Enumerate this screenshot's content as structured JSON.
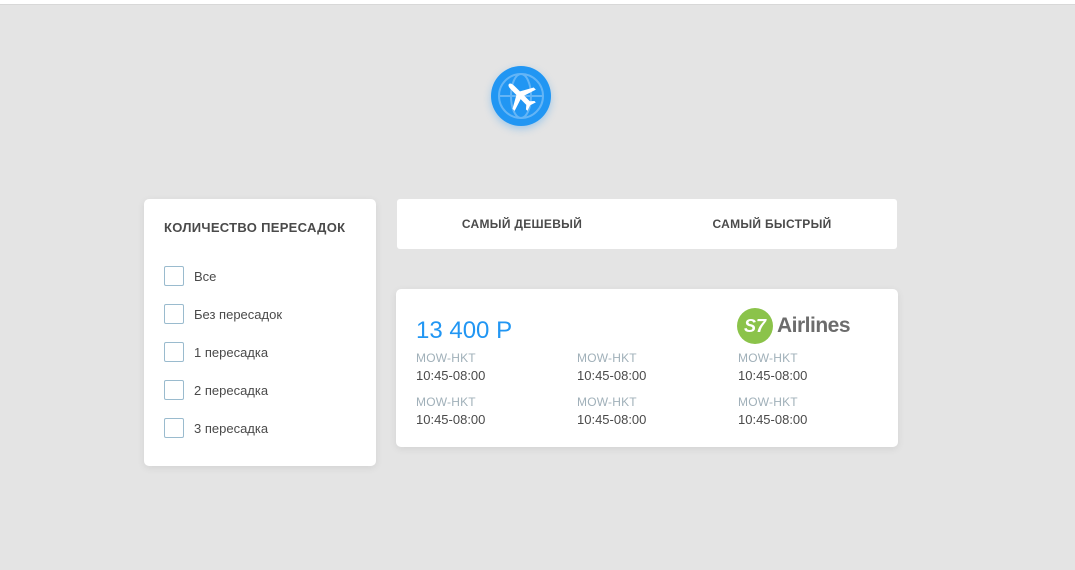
{
  "filter": {
    "title": "КОЛИЧЕСТВО ПЕРЕСАДОК",
    "options": [
      {
        "label": "Все"
      },
      {
        "label": "Без пересадок"
      },
      {
        "label": "1 пересадка"
      },
      {
        "label": "2 пересадка"
      },
      {
        "label": "3 пересадка"
      }
    ]
  },
  "tabs": [
    {
      "label": "САМЫЙ ДЕШЕВЫЙ"
    },
    {
      "label": "САМЫЙ БЫСТРЫЙ"
    }
  ],
  "ticket": {
    "price": "13 400 Р",
    "airline_mark": "S7",
    "airline_name": "Airlines",
    "segments": [
      {
        "route": "MOW-HKT",
        "time": "10:45-08:00"
      },
      {
        "route": "MOW-HKT",
        "time": "10:45-08:00"
      },
      {
        "route": "MOW-HKT",
        "time": "10:45-08:00"
      },
      {
        "route": "MOW-HKT",
        "time": "10:45-08:00"
      },
      {
        "route": "MOW-HKT",
        "time": "10:45-08:00"
      },
      {
        "route": "MOW-HKT",
        "time": "10:45-08:00"
      }
    ]
  },
  "colors": {
    "accent": "#2196f3",
    "airline": "#8bc34a",
    "background": "#e4e4e4"
  },
  "icons": {
    "logo": "airplane-globe-icon",
    "checkbox": "checkbox-unchecked"
  }
}
